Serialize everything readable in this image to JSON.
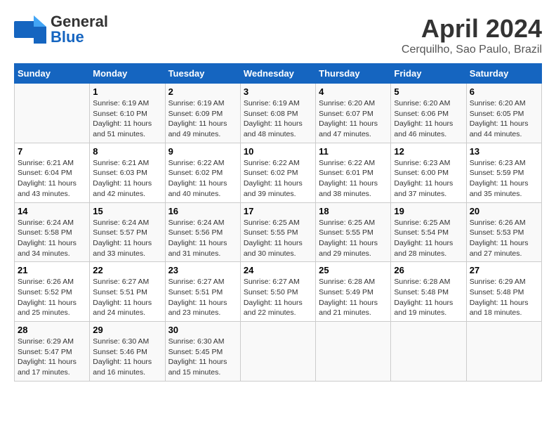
{
  "header": {
    "logo_general": "General",
    "logo_blue": "Blue",
    "month": "April 2024",
    "location": "Cerquilho, Sao Paulo, Brazil"
  },
  "weekdays": [
    "Sunday",
    "Monday",
    "Tuesday",
    "Wednesday",
    "Thursday",
    "Friday",
    "Saturday"
  ],
  "weeks": [
    [
      {
        "day": "",
        "info": ""
      },
      {
        "day": "1",
        "info": "Sunrise: 6:19 AM\nSunset: 6:10 PM\nDaylight: 11 hours\nand 51 minutes."
      },
      {
        "day": "2",
        "info": "Sunrise: 6:19 AM\nSunset: 6:09 PM\nDaylight: 11 hours\nand 49 minutes."
      },
      {
        "day": "3",
        "info": "Sunrise: 6:19 AM\nSunset: 6:08 PM\nDaylight: 11 hours\nand 48 minutes."
      },
      {
        "day": "4",
        "info": "Sunrise: 6:20 AM\nSunset: 6:07 PM\nDaylight: 11 hours\nand 47 minutes."
      },
      {
        "day": "5",
        "info": "Sunrise: 6:20 AM\nSunset: 6:06 PM\nDaylight: 11 hours\nand 46 minutes."
      },
      {
        "day": "6",
        "info": "Sunrise: 6:20 AM\nSunset: 6:05 PM\nDaylight: 11 hours\nand 44 minutes."
      }
    ],
    [
      {
        "day": "7",
        "info": "Sunrise: 6:21 AM\nSunset: 6:04 PM\nDaylight: 11 hours\nand 43 minutes."
      },
      {
        "day": "8",
        "info": "Sunrise: 6:21 AM\nSunset: 6:03 PM\nDaylight: 11 hours\nand 42 minutes."
      },
      {
        "day": "9",
        "info": "Sunrise: 6:22 AM\nSunset: 6:02 PM\nDaylight: 11 hours\nand 40 minutes."
      },
      {
        "day": "10",
        "info": "Sunrise: 6:22 AM\nSunset: 6:02 PM\nDaylight: 11 hours\nand 39 minutes."
      },
      {
        "day": "11",
        "info": "Sunrise: 6:22 AM\nSunset: 6:01 PM\nDaylight: 11 hours\nand 38 minutes."
      },
      {
        "day": "12",
        "info": "Sunrise: 6:23 AM\nSunset: 6:00 PM\nDaylight: 11 hours\nand 37 minutes."
      },
      {
        "day": "13",
        "info": "Sunrise: 6:23 AM\nSunset: 5:59 PM\nDaylight: 11 hours\nand 35 minutes."
      }
    ],
    [
      {
        "day": "14",
        "info": "Sunrise: 6:24 AM\nSunset: 5:58 PM\nDaylight: 11 hours\nand 34 minutes."
      },
      {
        "day": "15",
        "info": "Sunrise: 6:24 AM\nSunset: 5:57 PM\nDaylight: 11 hours\nand 33 minutes."
      },
      {
        "day": "16",
        "info": "Sunrise: 6:24 AM\nSunset: 5:56 PM\nDaylight: 11 hours\nand 31 minutes."
      },
      {
        "day": "17",
        "info": "Sunrise: 6:25 AM\nSunset: 5:55 PM\nDaylight: 11 hours\nand 30 minutes."
      },
      {
        "day": "18",
        "info": "Sunrise: 6:25 AM\nSunset: 5:55 PM\nDaylight: 11 hours\nand 29 minutes."
      },
      {
        "day": "19",
        "info": "Sunrise: 6:25 AM\nSunset: 5:54 PM\nDaylight: 11 hours\nand 28 minutes."
      },
      {
        "day": "20",
        "info": "Sunrise: 6:26 AM\nSunset: 5:53 PM\nDaylight: 11 hours\nand 27 minutes."
      }
    ],
    [
      {
        "day": "21",
        "info": "Sunrise: 6:26 AM\nSunset: 5:52 PM\nDaylight: 11 hours\nand 25 minutes."
      },
      {
        "day": "22",
        "info": "Sunrise: 6:27 AM\nSunset: 5:51 PM\nDaylight: 11 hours\nand 24 minutes."
      },
      {
        "day": "23",
        "info": "Sunrise: 6:27 AM\nSunset: 5:51 PM\nDaylight: 11 hours\nand 23 minutes."
      },
      {
        "day": "24",
        "info": "Sunrise: 6:27 AM\nSunset: 5:50 PM\nDaylight: 11 hours\nand 22 minutes."
      },
      {
        "day": "25",
        "info": "Sunrise: 6:28 AM\nSunset: 5:49 PM\nDaylight: 11 hours\nand 21 minutes."
      },
      {
        "day": "26",
        "info": "Sunrise: 6:28 AM\nSunset: 5:48 PM\nDaylight: 11 hours\nand 19 minutes."
      },
      {
        "day": "27",
        "info": "Sunrise: 6:29 AM\nSunset: 5:48 PM\nDaylight: 11 hours\nand 18 minutes."
      }
    ],
    [
      {
        "day": "28",
        "info": "Sunrise: 6:29 AM\nSunset: 5:47 PM\nDaylight: 11 hours\nand 17 minutes."
      },
      {
        "day": "29",
        "info": "Sunrise: 6:30 AM\nSunset: 5:46 PM\nDaylight: 11 hours\nand 16 minutes."
      },
      {
        "day": "30",
        "info": "Sunrise: 6:30 AM\nSunset: 5:45 PM\nDaylight: 11 hours\nand 15 minutes."
      },
      {
        "day": "",
        "info": ""
      },
      {
        "day": "",
        "info": ""
      },
      {
        "day": "",
        "info": ""
      },
      {
        "day": "",
        "info": ""
      }
    ]
  ]
}
